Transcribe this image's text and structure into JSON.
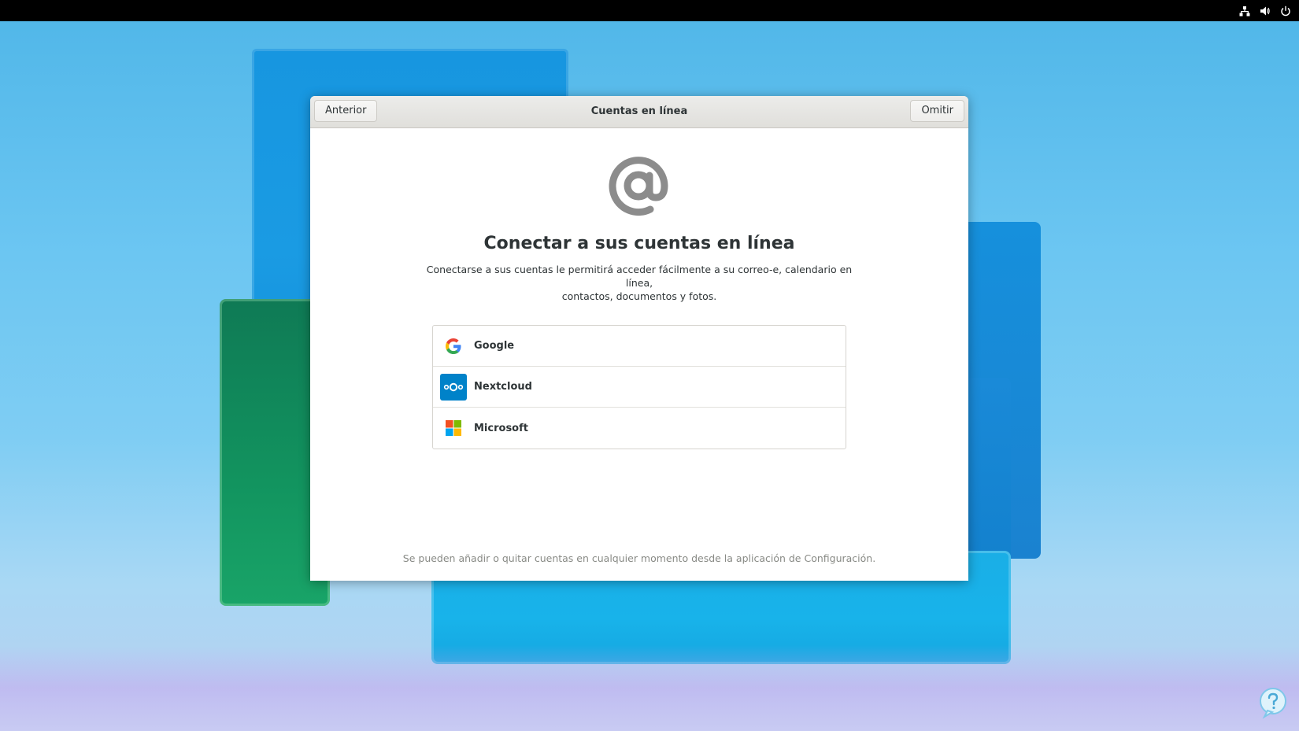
{
  "topbar": {
    "icons": [
      "network-icon",
      "volume-icon",
      "power-icon"
    ]
  },
  "headerbar": {
    "back_label": "Anterior",
    "title": "Cuentas en línea",
    "skip_label": "Omitir"
  },
  "page": {
    "icon": "at-sign-icon",
    "title": "Conectar a sus cuentas en línea",
    "description_line1": "Conectarse a sus cuentas le permitirá acceder fácilmente a su correo-e, calendario en línea,",
    "description_line2": "contactos, documentos y fotos."
  },
  "providers": [
    {
      "label": "Google",
      "icon": "google-icon"
    },
    {
      "label": "Nextcloud",
      "icon": "nextcloud-icon"
    },
    {
      "label": "Microsoft",
      "icon": "microsoft-icon"
    }
  ],
  "footer": {
    "note": "Se pueden añadir o quitar cuentas en cualquier momento desde la aplicación de Configuración."
  },
  "colors": {
    "accent": "#1f6fd8",
    "nextcloud": "#0082c9",
    "text": "#2e3436",
    "muted": "#888a85"
  }
}
